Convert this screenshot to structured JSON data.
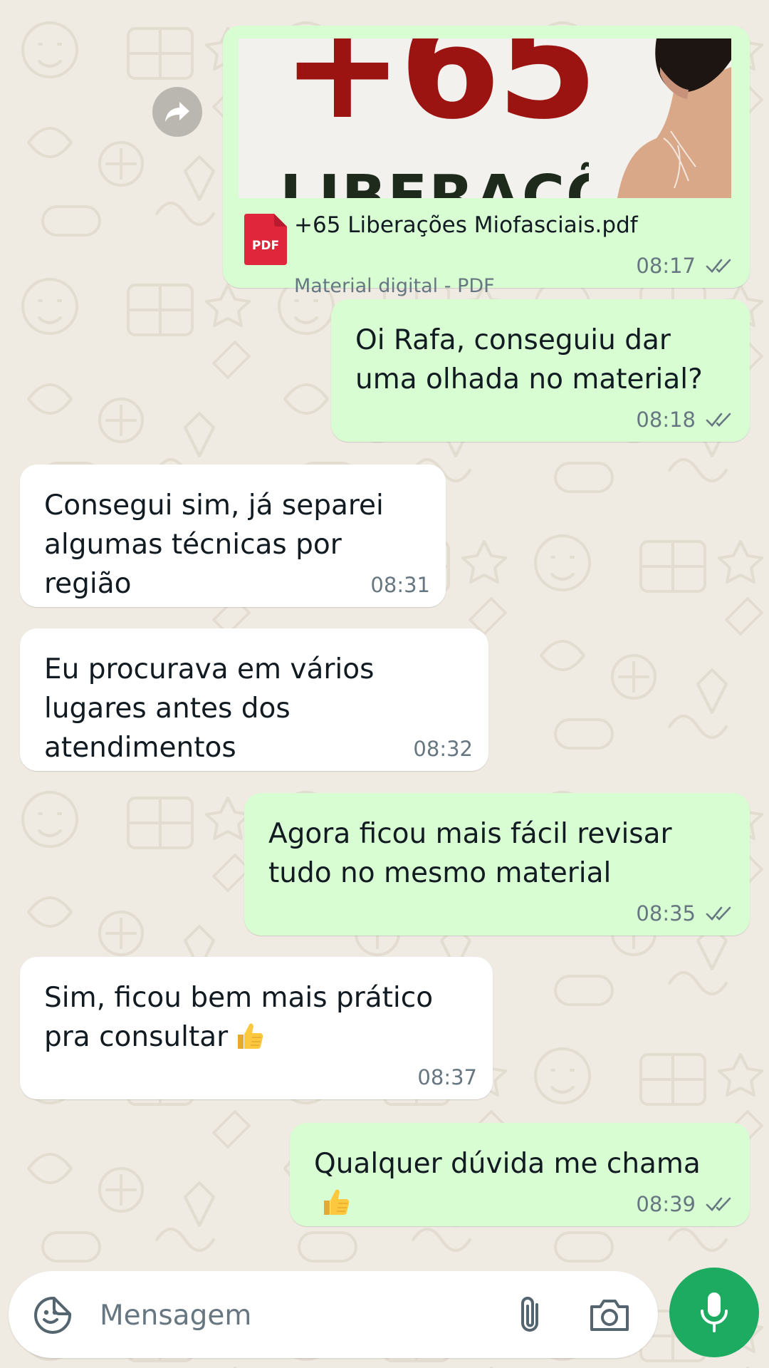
{
  "conversation": {
    "pdf_message": {
      "thumbnail_title": "+65",
      "thumbnail_subtitle": "LIBERAÇÕES",
      "file_badge": "PDF",
      "file_name": "+65 Liberações Miofasciais.pdf",
      "file_meta": "Material digital - PDF",
      "time": "08:17",
      "status": "read"
    },
    "messages": [
      {
        "direction": "outgoing",
        "text": "Oi Rafa, conseguiu dar uma olhada no material?",
        "time": "08:18",
        "status": "read"
      },
      {
        "direction": "incoming",
        "text": "Consegui sim, já separei algumas técnicas por região",
        "time": "08:31"
      },
      {
        "direction": "incoming",
        "text": "Eu procurava em vários lugares antes dos atendimentos",
        "time": "08:32"
      },
      {
        "direction": "outgoing",
        "text": "Agora ficou mais fácil revisar tudo no mesmo material",
        "time": "08:35",
        "status": "read"
      },
      {
        "direction": "incoming",
        "text": "Sim, ficou bem mais prático pra consultar",
        "emoji": "thumbs-up",
        "time": "08:37"
      },
      {
        "direction": "outgoing",
        "text": "Qualquer dúvida me chama",
        "emoji": "thumbs-up",
        "time": "08:39",
        "status": "read"
      }
    ]
  },
  "composer": {
    "placeholder": "Mensagem",
    "icons": [
      "sticker-icon",
      "attach-icon",
      "camera-icon",
      "mic-icon"
    ]
  },
  "colors": {
    "outgoing_bubble": "#d9fdd3",
    "incoming_bubble": "#ffffff",
    "background": "#efeae2",
    "accent": "#1daa61",
    "meta_text": "#667781",
    "pdf_red": "#e0263b"
  }
}
